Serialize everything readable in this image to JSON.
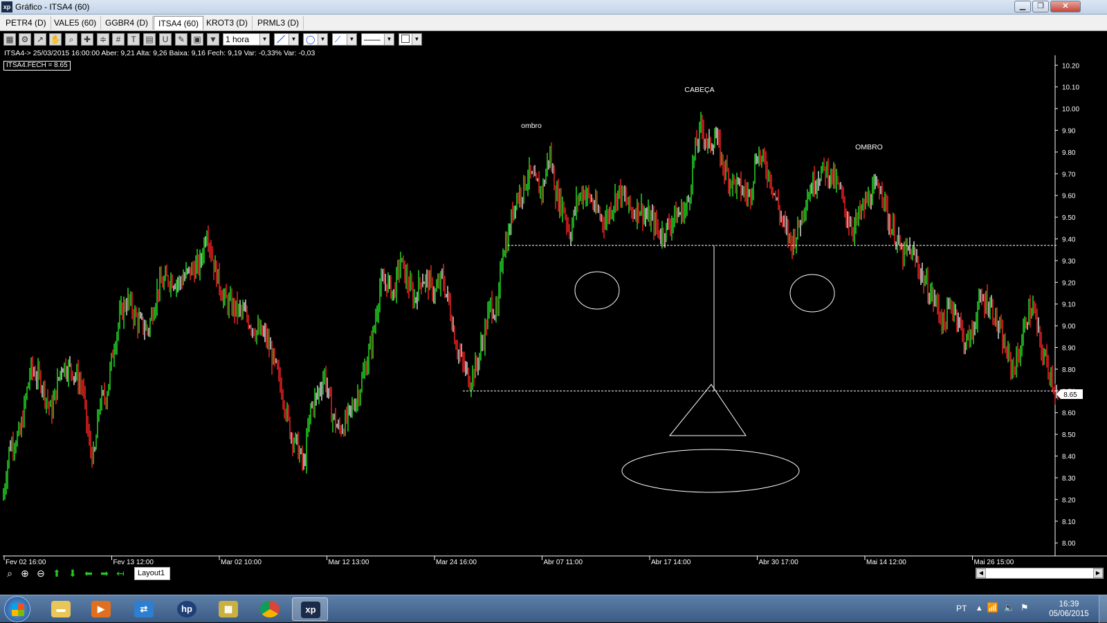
{
  "window": {
    "title": "Gráfico - ITSA4 (60)",
    "logo": "xp",
    "controls": [
      "minimize-icon",
      "maximize-icon",
      "close-icon"
    ]
  },
  "tabs": [
    {
      "label": "PETR4 (D)",
      "active": false
    },
    {
      "label": "VALE5 (60)",
      "active": false
    },
    {
      "label": "GGBR4 (D)",
      "active": false
    },
    {
      "label": "ITSA4 (60)",
      "active": true
    },
    {
      "label": "KROT3 (D)",
      "active": false
    },
    {
      "label": "PRML3 (D)",
      "active": false
    }
  ],
  "toolbar": {
    "icons": [
      "chart-icon",
      "settings-gear-icon",
      "trendline-icon",
      "hand-icon",
      "zoom-icon",
      "crosshair-icon",
      "fibonacci-icon",
      "grid-icon",
      "text-icon",
      "calculator-icon",
      "magnet-icon",
      "draw-icon",
      "clipboard-icon",
      "filter-icon"
    ],
    "period_value": "1 hora",
    "line_tool": "line-tool-icon",
    "shape_tool": "ellipse-tool-icon",
    "pen_tool": "pen-tool-icon",
    "line_style": "line-style-icon",
    "color_swatch": "#ffffff"
  },
  "info_line": "ITSA4-> 25/03/2015 16:00:00 Aber: 9,21 Alta: 9,26 Baixa: 9,16 Fech: 9,19 Var: -0,33% Var: -0,03",
  "series_badge": "ITSA4.FECH = 8.65",
  "chart_data": {
    "type": "bar",
    "symbol": "ITSA4",
    "interval": "60",
    "ylim": [
      7.94,
      10.22
    ],
    "yticks": [
      8.0,
      8.1,
      8.2,
      8.3,
      8.4,
      8.5,
      8.6,
      8.7,
      8.8,
      8.9,
      9.0,
      9.1,
      9.2,
      9.3,
      9.4,
      9.5,
      9.6,
      9.7,
      9.8,
      9.9,
      10.0,
      10.1,
      10.2
    ],
    "ytick_labels": [
      "8.00",
      "8.10",
      "8.20",
      "8.30",
      "8.40",
      "8.50",
      "8.60",
      "8.70",
      "8.80",
      "8.90",
      "9.00",
      "9.10",
      "9.20",
      "9.30",
      "9.40",
      "9.50",
      "9.60",
      "9.70",
      "9.80",
      "9.90",
      "10.00",
      "10.10",
      "10.20"
    ],
    "xtick_labels": [
      "Fev 02 16:00",
      "Fev 13 12:00",
      "Mar 02 10:00",
      "Mar 12 13:00",
      "Mar 24 16:00",
      "Abr 07 11:00",
      "Abr 17 14:00",
      "Abr 30 17:00",
      "Mai 14 12:00",
      "Mai 26 15:00"
    ],
    "last_value": "8.65",
    "up_color": "#22cc22",
    "down_color": "#e02020",
    "neutral_color": "#c8c8c8",
    "close_path": [
      [
        0,
        8.2
      ],
      [
        10,
        8.45
      ],
      [
        25,
        8.5
      ],
      [
        40,
        8.8
      ],
      [
        55,
        8.75
      ],
      [
        70,
        8.6
      ],
      [
        85,
        8.82
      ],
      [
        100,
        8.8
      ],
      [
        115,
        8.72
      ],
      [
        125,
        8.45
      ],
      [
        132,
        8.38
      ],
      [
        140,
        8.65
      ],
      [
        150,
        8.68
      ],
      [
        160,
        8.9
      ],
      [
        170,
        9.05
      ],
      [
        180,
        9.12
      ],
      [
        195,
        9.02
      ],
      [
        210,
        8.98
      ],
      [
        225,
        9.18
      ],
      [
        240,
        9.22
      ],
      [
        255,
        9.2
      ],
      [
        270,
        9.25
      ],
      [
        285,
        9.28
      ],
      [
        295,
        9.45
      ],
      [
        305,
        9.28
      ],
      [
        320,
        9.12
      ],
      [
        335,
        9.08
      ],
      [
        350,
        9.05
      ],
      [
        365,
        8.98
      ],
      [
        380,
        8.95
      ],
      [
        395,
        8.8
      ],
      [
        405,
        8.68
      ],
      [
        415,
        8.52
      ],
      [
        425,
        8.45
      ],
      [
        435,
        8.35
      ],
      [
        445,
        8.62
      ],
      [
        455,
        8.68
      ],
      [
        465,
        8.78
      ],
      [
        475,
        8.6
      ],
      [
        485,
        8.52
      ],
      [
        495,
        8.55
      ],
      [
        505,
        8.62
      ],
      [
        515,
        8.7
      ],
      [
        525,
        8.82
      ],
      [
        535,
        8.95
      ],
      [
        545,
        9.18
      ],
      [
        555,
        9.2
      ],
      [
        565,
        9.15
      ],
      [
        575,
        9.3
      ],
      [
        585,
        9.2
      ],
      [
        595,
        9.12
      ],
      [
        605,
        9.22
      ],
      [
        615,
        9.2
      ],
      [
        625,
        9.15
      ],
      [
        635,
        9.22
      ],
      [
        645,
        9.1
      ],
      [
        655,
        8.92
      ],
      [
        665,
        8.82
      ],
      [
        675,
        8.75
      ],
      [
        685,
        8.82
      ],
      [
        695,
        8.95
      ],
      [
        705,
        9.1
      ],
      [
        715,
        9.05
      ],
      [
        722,
        9.35
      ],
      [
        730,
        9.4
      ],
      [
        740,
        9.58
      ],
      [
        750,
        9.62
      ],
      [
        760,
        9.7
      ],
      [
        770,
        9.65
      ],
      [
        780,
        9.62
      ],
      [
        790,
        9.8
      ],
      [
        800,
        9.6
      ],
      [
        810,
        9.55
      ],
      [
        820,
        9.42
      ],
      [
        830,
        9.58
      ],
      [
        840,
        9.62
      ],
      [
        850,
        9.58
      ],
      [
        860,
        9.52
      ],
      [
        870,
        9.48
      ],
      [
        880,
        9.55
      ],
      [
        890,
        9.62
      ],
      [
        900,
        9.58
      ],
      [
        910,
        9.52
      ],
      [
        920,
        9.55
      ],
      [
        930,
        9.5
      ],
      [
        940,
        9.48
      ],
      [
        950,
        9.42
      ],
      [
        960,
        9.45
      ],
      [
        970,
        9.5
      ],
      [
        980,
        9.52
      ],
      [
        990,
        9.55
      ],
      [
        1000,
        9.8
      ],
      [
        1010,
        9.92
      ],
      [
        1020,
        9.82
      ],
      [
        1030,
        9.88
      ],
      [
        1040,
        9.75
      ],
      [
        1050,
        9.68
      ],
      [
        1060,
        9.65
      ],
      [
        1070,
        9.62
      ],
      [
        1080,
        9.6
      ],
      [
        1090,
        9.8
      ],
      [
        1100,
        9.75
      ],
      [
        1110,
        9.68
      ],
      [
        1120,
        9.55
      ],
      [
        1130,
        9.45
      ],
      [
        1140,
        9.38
      ],
      [
        1150,
        9.45
      ],
      [
        1160,
        9.58
      ],
      [
        1170,
        9.65
      ],
      [
        1180,
        9.7
      ],
      [
        1190,
        9.72
      ],
      [
        1200,
        9.68
      ],
      [
        1210,
        9.62
      ],
      [
        1220,
        9.5
      ],
      [
        1230,
        9.45
      ],
      [
        1240,
        9.52
      ],
      [
        1250,
        9.58
      ],
      [
        1260,
        9.62
      ],
      [
        1270,
        9.65
      ],
      [
        1280,
        9.48
      ],
      [
        1290,
        9.42
      ],
      [
        1300,
        9.32
      ],
      [
        1310,
        9.35
      ],
      [
        1320,
        9.3
      ],
      [
        1330,
        9.22
      ],
      [
        1340,
        9.15
      ],
      [
        1350,
        9.1
      ],
      [
        1360,
        9.0
      ],
      [
        1370,
        9.1
      ],
      [
        1380,
        9.05
      ],
      [
        1390,
        8.92
      ],
      [
        1400,
        8.95
      ],
      [
        1410,
        9.1
      ],
      [
        1420,
        9.12
      ],
      [
        1430,
        9.08
      ],
      [
        1440,
        8.98
      ],
      [
        1450,
        8.88
      ],
      [
        1460,
        8.8
      ],
      [
        1470,
        8.88
      ],
      [
        1480,
        9.05
      ],
      [
        1490,
        9.08
      ],
      [
        1500,
        8.9
      ],
      [
        1510,
        8.82
      ],
      [
        1520,
        8.72
      ],
      [
        1525,
        8.65
      ]
    ],
    "annotations": {
      "left_shoulder_label": "ombro",
      "head_label": "CABEÇA",
      "right_shoulder_label": "OMBRO",
      "neckline": {
        "price": 9.37,
        "from_index": 730,
        "to_index": 1525
      },
      "support": {
        "price": 8.7,
        "from_index": 665,
        "to_index": 1525
      },
      "target_projection": {
        "from_price": 9.37,
        "to_price": 8.7,
        "index": 1028
      }
    }
  },
  "bottom": {
    "nav_icons": [
      "zoom-reset-icon",
      "zoom-in-icon",
      "zoom-out-icon",
      "arrow-up-icon",
      "arrow-down-icon",
      "arrow-left-icon",
      "arrow-right-icon",
      "return-icon"
    ],
    "layout_tab": "Layout1"
  },
  "taskbar": {
    "apps": [
      "explorer-folder-icon",
      "media-player-icon",
      "network-icon",
      "hp-icon",
      "app-window-icon",
      "chrome-icon",
      "xp-app-icon"
    ],
    "lang": "PT",
    "time": "16:39",
    "date": "05/06/2015"
  }
}
